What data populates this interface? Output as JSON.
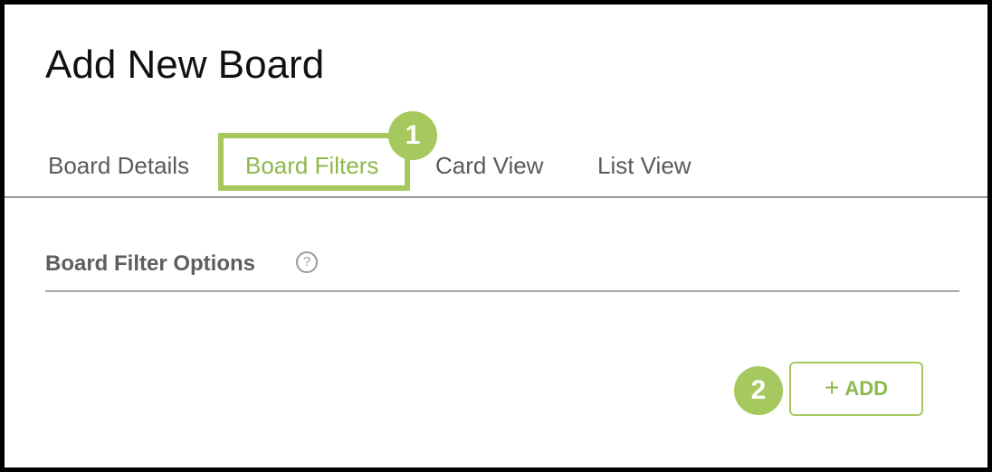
{
  "dialog": {
    "title": "Add New Board"
  },
  "tabs": [
    {
      "label": "Board Details",
      "active": false
    },
    {
      "label": "Board Filters",
      "active": true
    },
    {
      "label": "Card View",
      "active": false
    },
    {
      "label": "List View",
      "active": false
    }
  ],
  "section": {
    "title": "Board Filter Options",
    "help_icon": "question-circle-icon",
    "help_glyph": "?"
  },
  "add_button": {
    "label": "ADD",
    "icon": "plus-icon",
    "icon_glyph": "+"
  },
  "callouts": [
    {
      "label": "1"
    },
    {
      "label": "2"
    }
  ],
  "colors": {
    "accent": "#a5c95e",
    "accent_text": "#8db84a",
    "frame": "#000000",
    "text_dark": "#111111",
    "text_muted": "#5a5a5a"
  }
}
